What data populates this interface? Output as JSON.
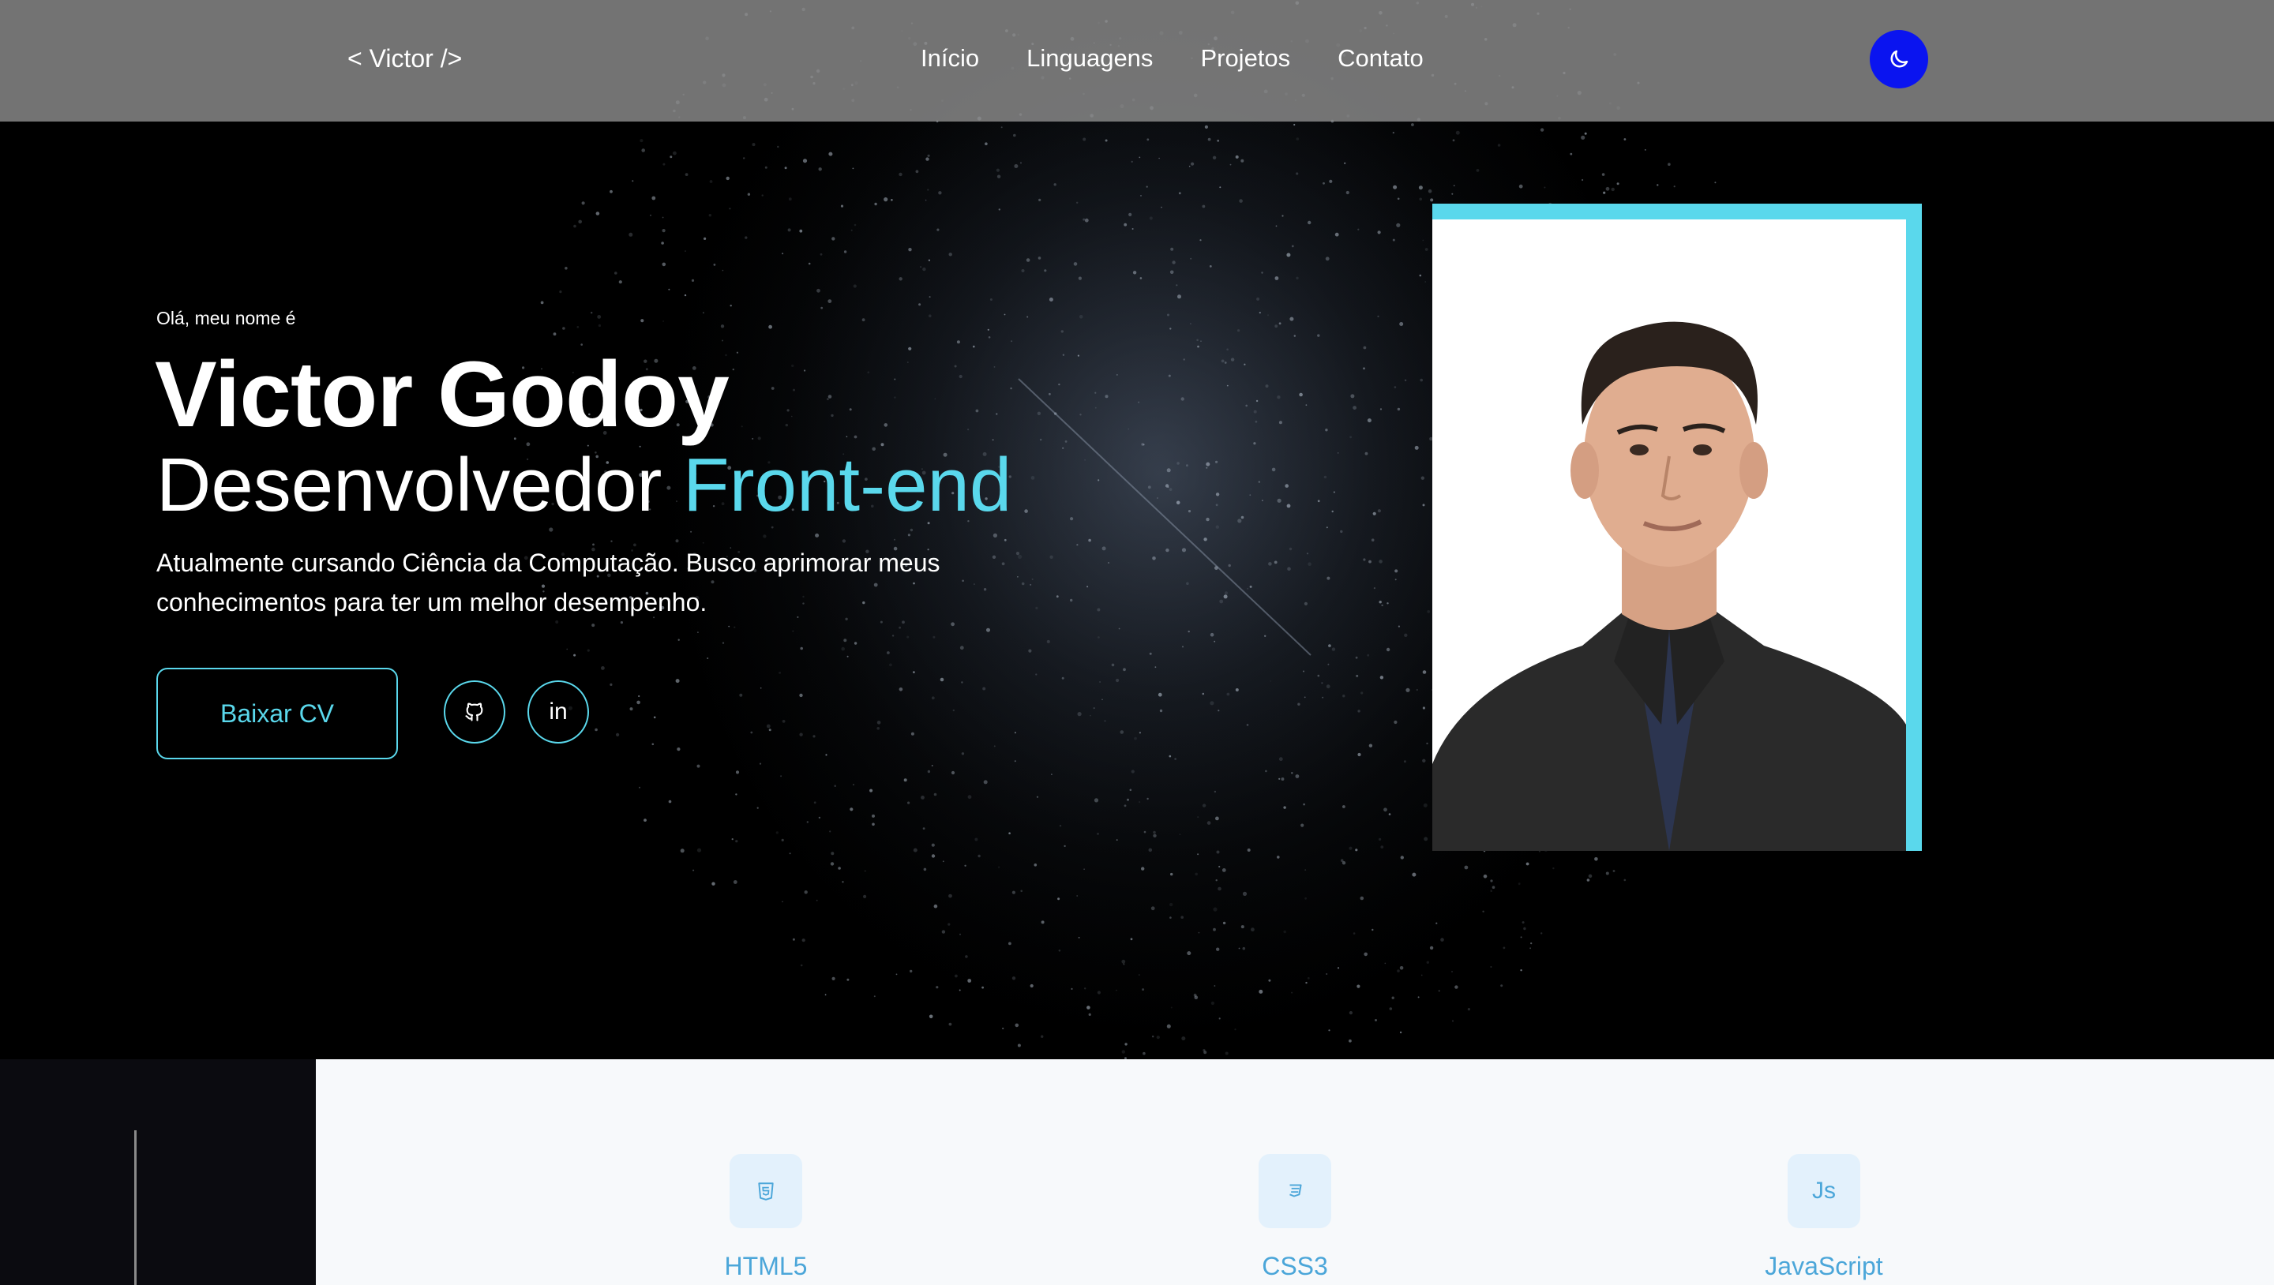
{
  "header": {
    "logo": "< Victor />",
    "nav": [
      "Início",
      "Linguagens",
      "Projetos",
      "Contato"
    ]
  },
  "hero": {
    "greeting": "Olá, meu nome é",
    "name": "Victor Godoy",
    "role_prefix": "Desenvolvedor ",
    "role_accent": "Front-end",
    "description": "Atualmente cursando Ciência da Computação. Busco aprimorar meus conhecimentos para ter um melhor desempenho.",
    "cv_button": "Baixar CV",
    "linkedin_label": "in"
  },
  "skills": [
    {
      "name": "HTML5",
      "icon": "html5-icon"
    },
    {
      "name": "CSS3",
      "icon": "css3-icon"
    },
    {
      "name": "JavaScript",
      "icon": "js-icon",
      "icon_text": "Js"
    }
  ],
  "colors": {
    "accent": "#5ad8ec",
    "toggle": "#0a14f0",
    "skill_text": "#4ba6d9",
    "skill_bg": "#e3f1fc"
  }
}
